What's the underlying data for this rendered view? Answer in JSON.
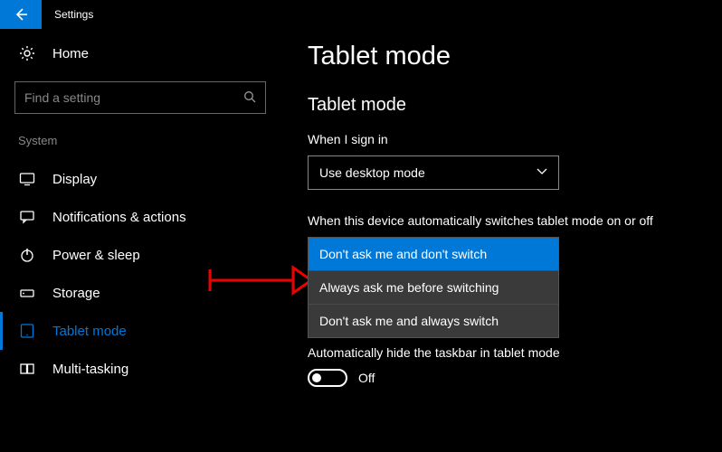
{
  "titlebar": {
    "app_name": "Settings"
  },
  "sidebar": {
    "home_label": "Home",
    "search_placeholder": "Find a setting",
    "category_label": "System",
    "items": [
      {
        "label": "Display"
      },
      {
        "label": "Notifications & actions"
      },
      {
        "label": "Power & sleep"
      },
      {
        "label": "Storage"
      },
      {
        "label": "Tablet mode"
      },
      {
        "label": "Multi-tasking"
      }
    ]
  },
  "main": {
    "page_title": "Tablet mode",
    "section_title": "Tablet mode",
    "signin_label": "When I sign in",
    "signin_value": "Use desktop mode",
    "switch_label": "When this device automatically switches tablet mode on or off",
    "switch_options": [
      "Don't ask me and don't switch",
      "Always ask me before switching",
      "Don't ask me and always switch"
    ],
    "hidden_toggle_text": "Off",
    "hide_taskbar_label": "Automatically hide the taskbar in tablet mode",
    "hide_taskbar_value": "Off"
  }
}
